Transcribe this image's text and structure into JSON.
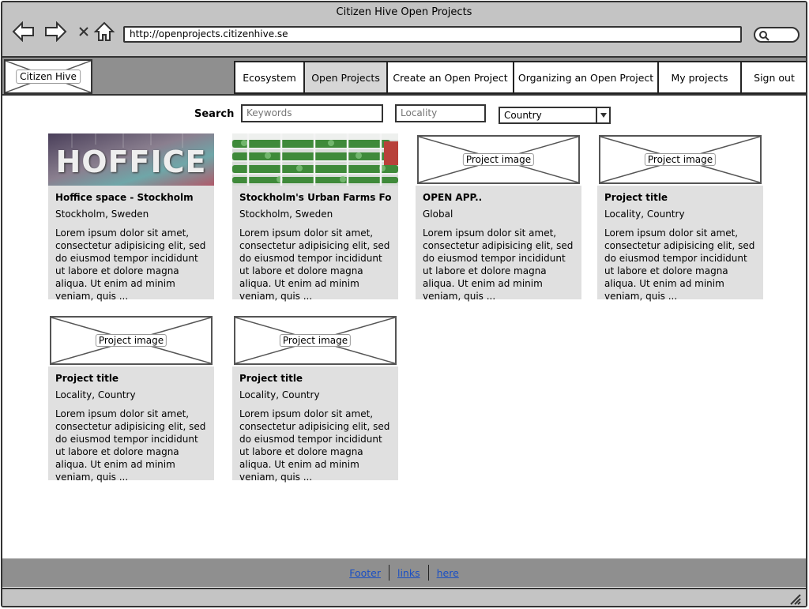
{
  "window": {
    "title": "Citizen Hive Open Projects"
  },
  "browser": {
    "url": "http://openprojects.citizenhive.se"
  },
  "header": {
    "logo": "Citizen Hive",
    "nav": [
      "Ecosystem",
      "Open Projects",
      "Create an Open Project",
      "Organizing an Open Project",
      "My projects",
      "Sign out"
    ],
    "active_nav": "Open Projects"
  },
  "search": {
    "label": "Search",
    "keywords_placeholder": "Keywords",
    "locality_placeholder": "Locality",
    "country_selected": "Country"
  },
  "cards": [
    {
      "title": "Hoffice space - Stockholm",
      "location": "Stockholm, Sweden",
      "image": "HOFFICE",
      "desc": "Lorem ipsum dolor sit amet, consectetur adipisicing elit, sed do eiusmod tempor incididunt ut labore et dolore magna aliqua. Ut enim ad minim veniam, quis  ..."
    },
    {
      "title": "Stockholm's Urban Farms Force",
      "location": "Stockholm, Sweden",
      "image": "",
      "desc": "Lorem ipsum dolor sit amet, consectetur adipisicing elit, sed do eiusmod tempor incididunt ut labore et dolore magna aliqua. Ut enim ad minim veniam, quis  ..."
    },
    {
      "title": "OPEN APP..",
      "location": "Global",
      "image": "Project image",
      "desc": "Lorem ipsum dolor sit amet, consectetur adipisicing elit, sed do eiusmod tempor incididunt ut labore et dolore magna aliqua. Ut enim ad minim veniam, quis  ..."
    },
    {
      "title": "Project title",
      "location": "Locality, Country",
      "image": "Project image",
      "desc": "Lorem ipsum dolor sit amet, consectetur adipisicing elit, sed do eiusmod tempor incididunt ut labore et dolore magna aliqua. Ut enim ad minim veniam, quis  ..."
    },
    {
      "title": "Project title",
      "location": "Locality, Country",
      "image": "Project image",
      "desc": "Lorem ipsum dolor sit amet, consectetur adipisicing elit, sed do eiusmod tempor incididunt ut labore et dolore magna aliqua. Ut enim ad minim veniam, quis  ..."
    },
    {
      "title": "Project title",
      "location": "Locality, Country",
      "image": "Project image",
      "desc": "Lorem ipsum dolor sit amet, consectetur adipisicing elit, sed do eiusmod tempor incididunt ut labore et dolore magna aliqua. Ut enim ad minim veniam, quis  ..."
    }
  ],
  "footer": {
    "links": [
      "Footer",
      "links",
      "here"
    ]
  },
  "colors": {
    "chrome": "#c4c4c4",
    "header": "#8f8f8f",
    "card": "#e0e0e0",
    "link": "#1a4fc4"
  }
}
